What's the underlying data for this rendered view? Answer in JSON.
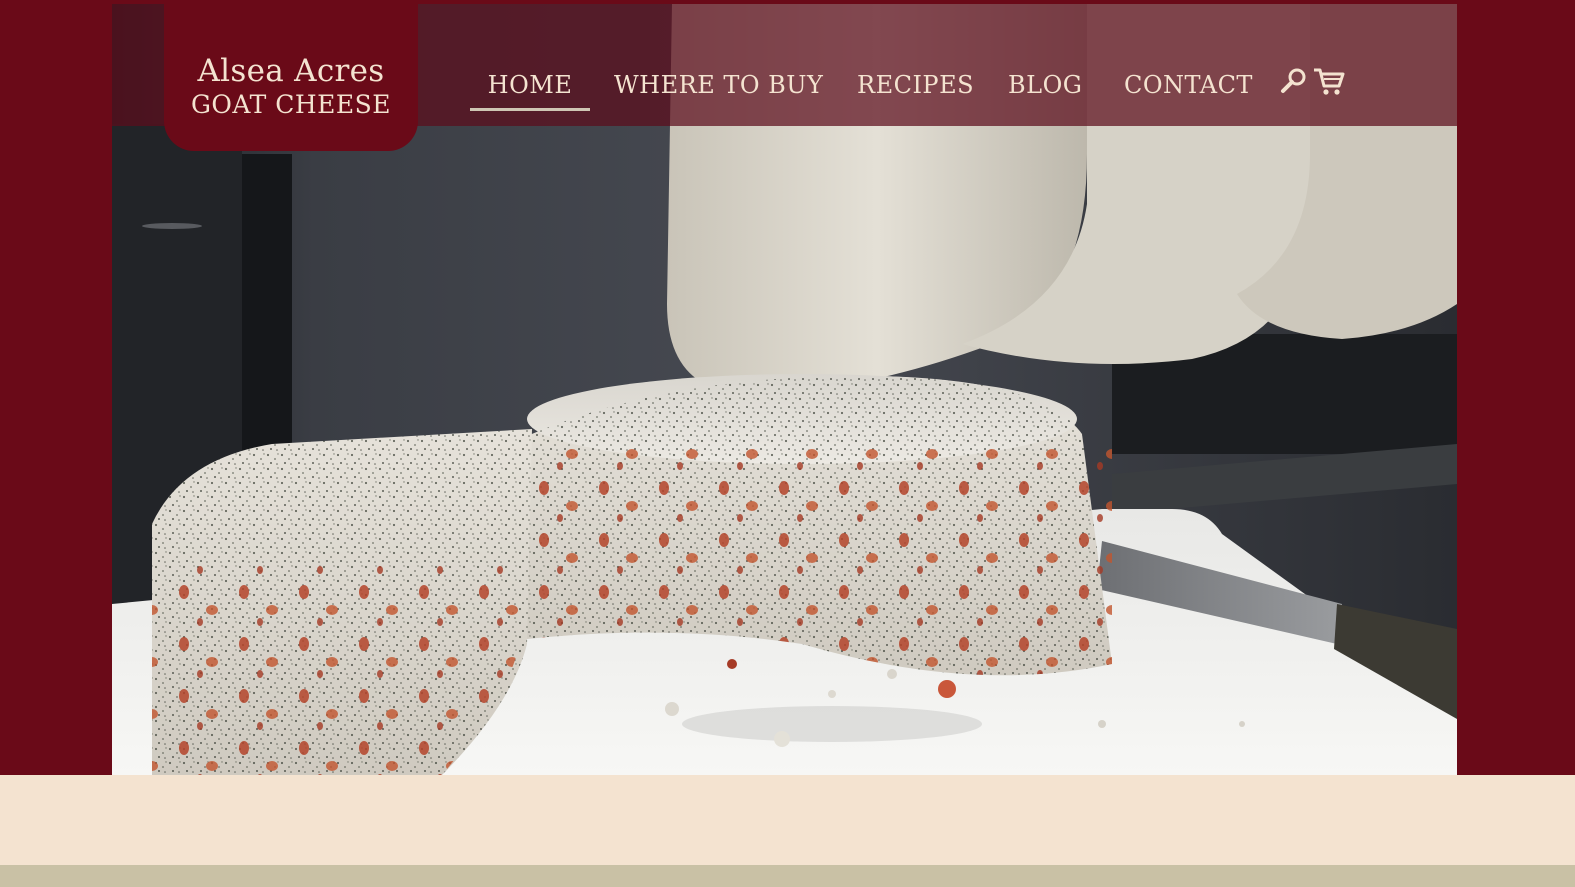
{
  "logo": {
    "line1": "Alsea Acres",
    "line2": "GOAT CHEESE"
  },
  "nav": {
    "items": [
      {
        "label": "HOME",
        "active": true
      },
      {
        "label": "WHERE TO BUY",
        "active": false
      },
      {
        "label": "RECIPES",
        "active": false
      },
      {
        "label": "BLOG",
        "active": false
      },
      {
        "label": "CONTACT",
        "active": false
      }
    ],
    "icons": [
      "search-icon",
      "cart-icon"
    ]
  },
  "colors": {
    "brand_maroon": "#6a0a18",
    "nav_text": "#f4e3d0",
    "cream_band": "#f4e3d0",
    "footer_band": "#c9c1a5"
  },
  "hero": {
    "subject": "photo-of-herbed-goat-cheese-wheel"
  }
}
